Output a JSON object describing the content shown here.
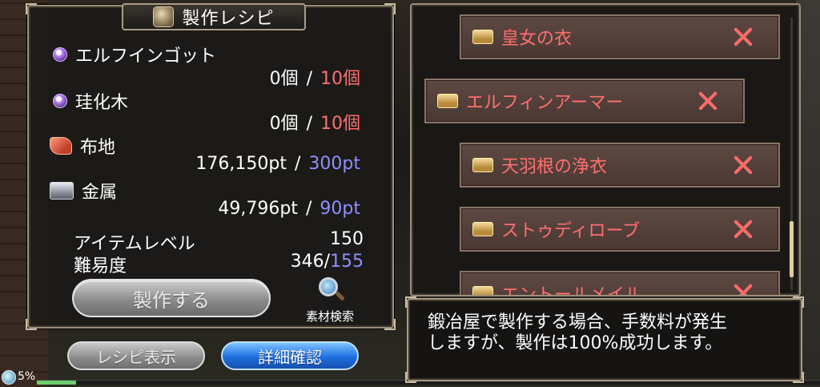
{
  "panel": {
    "title": "製作レシピ",
    "materials": [
      {
        "name": "エルフインゴット",
        "have": "0個",
        "need": "10個",
        "icon": "orb-icon",
        "need_color": "red"
      },
      {
        "name": "珪化木",
        "have": "0個",
        "need": "10個",
        "icon": "orb-icon",
        "need_color": "red"
      },
      {
        "name": "布地",
        "have": "176,150pt",
        "need": "300pt",
        "icon": "cloth-icon",
        "need_color": "blue"
      },
      {
        "name": "金属",
        "have": "49,796pt",
        "need": "90pt",
        "icon": "metal-icon",
        "need_color": "blue"
      }
    ],
    "separator": "/",
    "item_level_label": "アイテムレベル",
    "item_level_value": "150",
    "difficulty_label": "難易度",
    "difficulty_value": "346/",
    "difficulty_max": "155",
    "craft_button": "製作する",
    "search_label": "素材検索"
  },
  "bottom_buttons": {
    "recipe": "レシピ表示",
    "detail": "詳細確認"
  },
  "status": {
    "percent": "5%",
    "progress": 0.05
  },
  "list": {
    "items": [
      {
        "name": "皇女の衣"
      },
      {
        "name": "エルフィンアーマー"
      },
      {
        "name": "天羽根の浄衣"
      },
      {
        "name": "ストゥディローブ"
      },
      {
        "name": "エントールメイル"
      }
    ]
  },
  "message": {
    "line1": "鍛冶屋で製作する場合、手数料が発生",
    "line2": "しますが、製作は100%成功します。"
  },
  "colors": {
    "red_value": "#ff6e6e",
    "blue_value": "#8f8fff",
    "detail_button": "#1e6fe0",
    "item_text": "#ff6e6e"
  }
}
